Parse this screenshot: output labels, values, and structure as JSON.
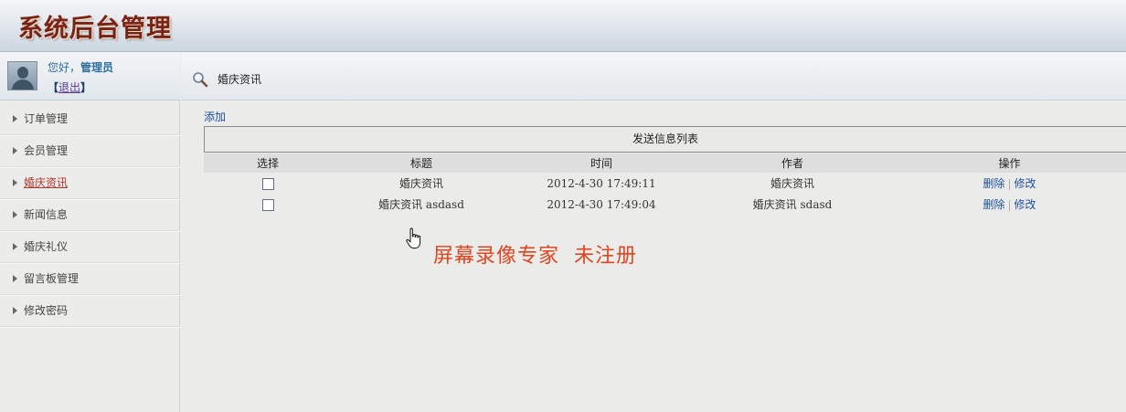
{
  "header": {
    "title": "系统后台管理"
  },
  "user": {
    "greeting_prefix": "您好，",
    "name": "管理员",
    "logout_open": "【",
    "logout_label": "退出",
    "logout_close": "】"
  },
  "sidebar": {
    "items": [
      {
        "label": "订单管理"
      },
      {
        "label": "会员管理"
      },
      {
        "label": "婚庆资讯",
        "active": true
      },
      {
        "label": "新闻信息"
      },
      {
        "label": "婚庆礼仪"
      },
      {
        "label": "留言板管理"
      },
      {
        "label": "修改密码"
      }
    ]
  },
  "breadcrumb": {
    "text": "婚庆资讯"
  },
  "actions": {
    "add_label": "添加"
  },
  "list": {
    "caption": "发送信息列表",
    "columns": [
      "选择",
      "标题",
      "时间",
      "作者",
      "操作"
    ],
    "rows": [
      {
        "title": "婚庆资讯",
        "time": "2012-4-30 17:49:11",
        "author": "婚庆资讯",
        "delete": "删除",
        "sep": "|",
        "edit": "修改"
      },
      {
        "title": "婚庆资讯 asdasd",
        "time": "2012-4-30 17:49:04",
        "author": "婚庆资讯 sdasd",
        "delete": "删除",
        "sep": "|",
        "edit": "修改"
      }
    ]
  },
  "watermark": {
    "text": "屏幕录像专家  未注册"
  },
  "colors": {
    "title_brown": "#7a2314",
    "link_blue": "#1f4f9c",
    "active_red": "#b0372b",
    "watermark_orange": "#e0451f"
  }
}
